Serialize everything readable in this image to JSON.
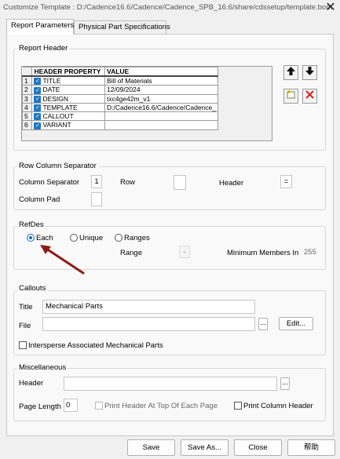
{
  "window": {
    "title": "Customize Template : D:/Cadence16.6/Cadence/Cadence_SPB_16.6/share/cdssetup/template.bom",
    "close_glyph": "✕"
  },
  "tabs": [
    {
      "label": "Report Parameters"
    },
    {
      "label": "Physical Part Specifications"
    }
  ],
  "report_header": {
    "group_label": "Report Header",
    "columns": [
      "HEADER PROPERTY",
      "VALUE"
    ],
    "rows": [
      {
        "num": "1",
        "property": "TITLE",
        "value": "Bill of Materials",
        "checked": true
      },
      {
        "num": "2",
        "property": "DATE",
        "value": "12/09/2024",
        "checked": true
      },
      {
        "num": "3",
        "property": "DESIGN",
        "value": "txc4ge42m_v1",
        "checked": true
      },
      {
        "num": "4",
        "property": "TEMPLATE",
        "value": "D:/Cadence16.6/Cadence/Cadence_",
        "checked": true
      },
      {
        "num": "5",
        "property": "CALLOUT",
        "value": "",
        "checked": true
      },
      {
        "num": "6",
        "property": "VARIANT",
        "value": "",
        "checked": true
      }
    ],
    "icons": [
      "arrow-up-icon",
      "arrow-down-icon",
      "add-row-icon",
      "delete-row-icon"
    ]
  },
  "row_column_separator": {
    "group_label": "Row Column Separator",
    "column_separator_label": "Column Separator",
    "column_separator_value": "1",
    "row_label": "Row",
    "row_value": "",
    "header_label": "Header",
    "header_value": "=",
    "column_pad_label": "Column Pad",
    "column_pad_value": ""
  },
  "refdes": {
    "group_label": "RefDes",
    "options": [
      "Each",
      "Unique",
      "Ranges"
    ],
    "selected": "Each",
    "range_label": "Range",
    "range_value": "-",
    "min_members_label": "Minimum Members In",
    "min_members_value": "255"
  },
  "callouts": {
    "group_label": "Callouts",
    "title_label": "Title",
    "title_value": "Mechanical Parts",
    "file_label": "File",
    "file_value": "",
    "browse_label": "...",
    "edit_label": "Edit...",
    "intersperse_label": "Intersperse Associated Mechanical Parts",
    "intersperse_checked": false
  },
  "misc": {
    "group_label": "Miscellaneous",
    "header_label": "Header",
    "header_value": "",
    "browse_label": "...",
    "page_length_label": "Page Length",
    "page_length_value": "0",
    "print_header_label": "Print Header At Top Of Each Page",
    "print_column_header_label": "Print Column Header"
  },
  "footer": {
    "save": "Save",
    "save_as": "Save As...",
    "close": "Close",
    "help": "帮助"
  },
  "colors": {
    "accent": "#1e78c8",
    "annotation_arrow": "#8b1a1a"
  }
}
